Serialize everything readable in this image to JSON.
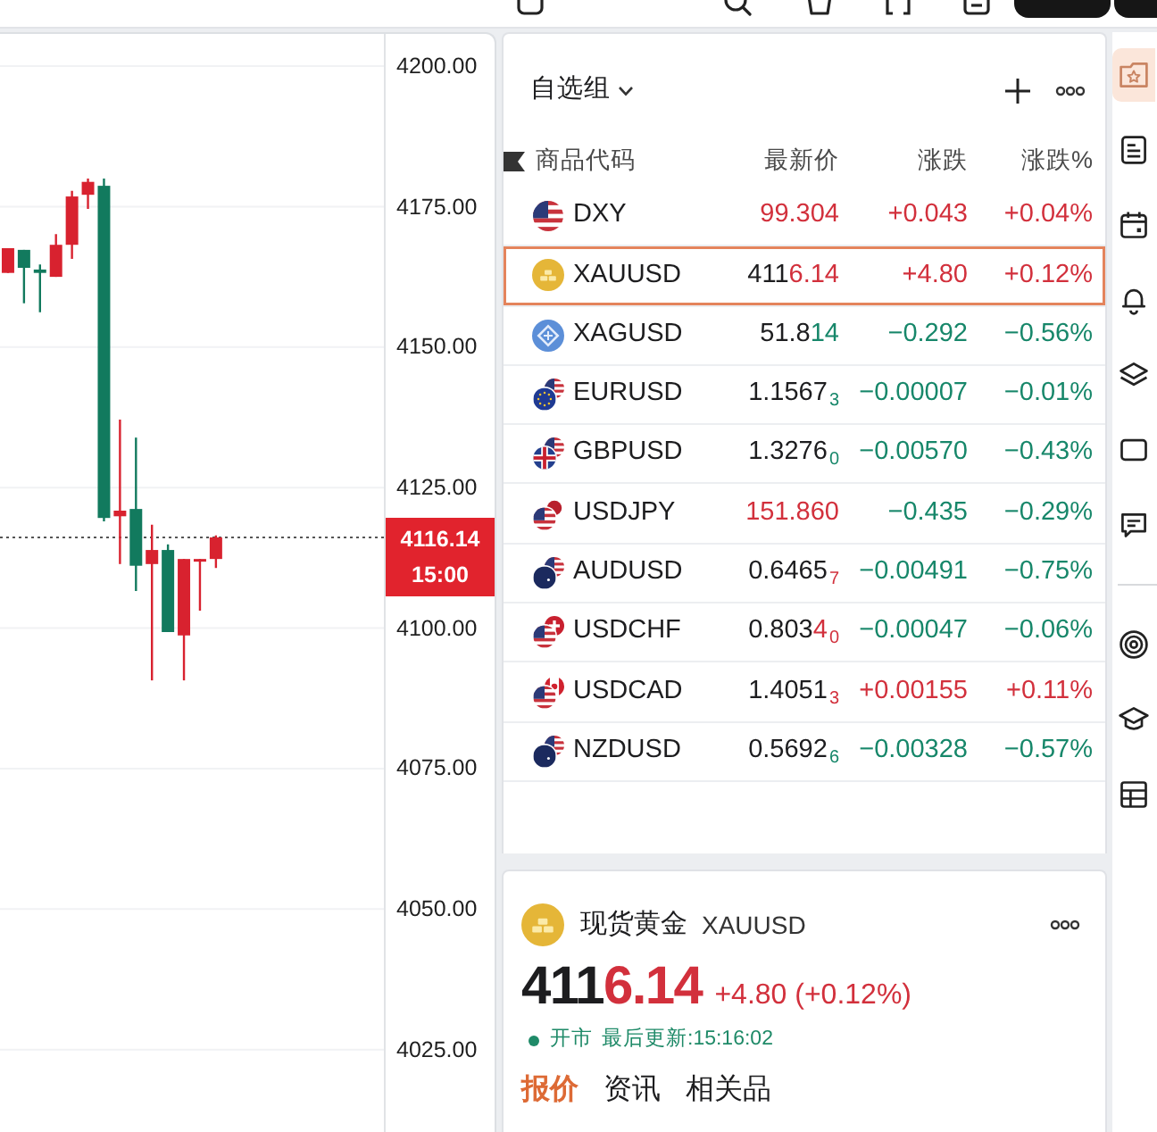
{
  "chart": {
    "chart_data": {
      "type": "candlestick",
      "ohlc": [
        [
          4163.2,
          4167.6,
          4163.2,
          4167.6
        ],
        [
          4167.3,
          4167.3,
          4157.8,
          4164.1
        ],
        [
          4163.8,
          4164.7,
          4156.2,
          4163.2
        ],
        [
          4162.5,
          4170.1,
          4162.5,
          4168.2
        ],
        [
          4168.2,
          4177.8,
          4165.7,
          4176.8
        ],
        [
          4177.1,
          4180.0,
          4174.6,
          4179.4
        ],
        [
          4178.7,
          4180.0,
          4119.0,
          4119.6
        ],
        [
          4119.9,
          4137.1,
          4111.4,
          4120.9
        ],
        [
          4121.2,
          4133.9,
          4106.6,
          4111.1
        ],
        [
          4111.4,
          4118.4,
          4090.7,
          4113.9
        ],
        [
          4113.9,
          4114.9,
          4099.3,
          4099.3
        ],
        [
          4098.7,
          4112.3,
          4090.7,
          4112.3
        ],
        [
          4112.0,
          4112.3,
          4103.1,
          4112.3
        ],
        [
          4112.3,
          4116.5,
          4110.7,
          4116.14
        ],
        null,
        null,
        null,
        null,
        null,
        null,
        null,
        null,
        null,
        null
      ],
      "ylim": [
        4010.35,
        4205.72
      ],
      "yticks": [
        {
          "value": 4200,
          "label": "4200.00"
        },
        {
          "value": 4175,
          "label": "4175.00"
        },
        {
          "value": 4150,
          "label": "4150.00"
        },
        {
          "value": 4125,
          "label": "4125.00"
        },
        {
          "value": 4100,
          "label": "4100.00"
        },
        {
          "value": 4075,
          "label": "4075.00"
        },
        {
          "value": 4050,
          "label": "4050.00"
        },
        {
          "value": 4025,
          "label": "4025.00"
        }
      ],
      "grid": true,
      "ref_lines": [
        {
          "axis": "y",
          "value": 4116.14,
          "label": "4116.14",
          "color": "#555555"
        }
      ]
    },
    "last_price_tag": {
      "countdown": "15:00"
    }
  },
  "watchlist": {
    "title": "自选组",
    "columns": [
      "商品代码",
      "最新价",
      "涨跌",
      "涨跌%"
    ],
    "rows": [
      {
        "symbol": "DXY",
        "price_moved": "99.304",
        "price_tick_up": true,
        "change": "+0.043",
        "change_percent": "+0.04%",
        "change_up": true,
        "selected": false
      },
      {
        "symbol": "XAUUSD",
        "price_static": "411",
        "price_moved": "6.14",
        "price_tick_up": true,
        "change": "+4.80",
        "change_percent": "+0.12%",
        "change_up": true,
        "selected": true
      },
      {
        "symbol": "XAGUSD",
        "price_static": "51.8",
        "price_moved": "14",
        "price_tick_up": false,
        "change": "−0.292",
        "change_percent": "−0.56%",
        "change_up": false,
        "selected": false
      },
      {
        "symbol": "EURUSD",
        "price_static": "1.1567",
        "price_pip": "3",
        "price_tick_up": false,
        "change": "−0.00007",
        "change_percent": "−0.01%",
        "change_up": false,
        "selected": false
      },
      {
        "symbol": "GBPUSD",
        "price_static": "1.3276",
        "price_pip": "0",
        "price_tick_up": false,
        "change": "−0.00570",
        "change_percent": "−0.43%",
        "change_up": false,
        "selected": false
      },
      {
        "symbol": "USDJPY",
        "price_moved": "151.860",
        "price_tick_up": true,
        "change": "−0.435",
        "change_percent": "−0.29%",
        "change_up": false,
        "selected": false
      },
      {
        "symbol": "AUDUSD",
        "price_static": "0.6465",
        "price_pip": "7",
        "price_tick_up": true,
        "change": "−0.00491",
        "change_percent": "−0.75%",
        "change_up": false,
        "selected": false
      },
      {
        "symbol": "USDCHF",
        "price_static": "0.803",
        "price_moved": "4",
        "price_pip": "0",
        "price_tick_up": true,
        "change": "−0.00047",
        "change_percent": "−0.06%",
        "change_up": false,
        "selected": false
      },
      {
        "symbol": "USDCAD",
        "price_static": "1.4051",
        "price_pip": "3",
        "price_tick_up": true,
        "change": "+0.00155",
        "change_percent": "+0.11%",
        "change_up": true,
        "selected": false
      },
      {
        "symbol": "NZDUSD",
        "price_static": "0.5692",
        "price_pip": "6",
        "price_tick_up": false,
        "change": "−0.00328",
        "change_percent": "−0.57%",
        "change_up": false,
        "selected": false
      }
    ]
  },
  "detail": {
    "name": "现货黄金",
    "symbol": "XAUUSD",
    "price_static": "411",
    "price_moved": "6.14",
    "price_tick_up": true,
    "change": "+4.80 (+0.12%)",
    "change_up": true,
    "market_open": true,
    "market_status": "开市",
    "last_update": "最后更新:15:16:02",
    "tabs": [
      {
        "label": "报价",
        "selected": true
      },
      {
        "label": "资讯",
        "selected": false
      },
      {
        "label": "相关品",
        "selected": false
      }
    ]
  },
  "sidebar": {
    "groups": [
      {
        "items": [
          {
            "selected": true
          },
          {
            "selected": false
          },
          {
            "selected": false
          },
          {
            "selected": false
          },
          {
            "selected": false
          },
          {
            "selected": false
          },
          {
            "selected": false
          }
        ]
      },
      {
        "items": [
          {
            "selected": false
          },
          {
            "selected": false
          },
          {
            "selected": false
          }
        ]
      }
    ]
  }
}
